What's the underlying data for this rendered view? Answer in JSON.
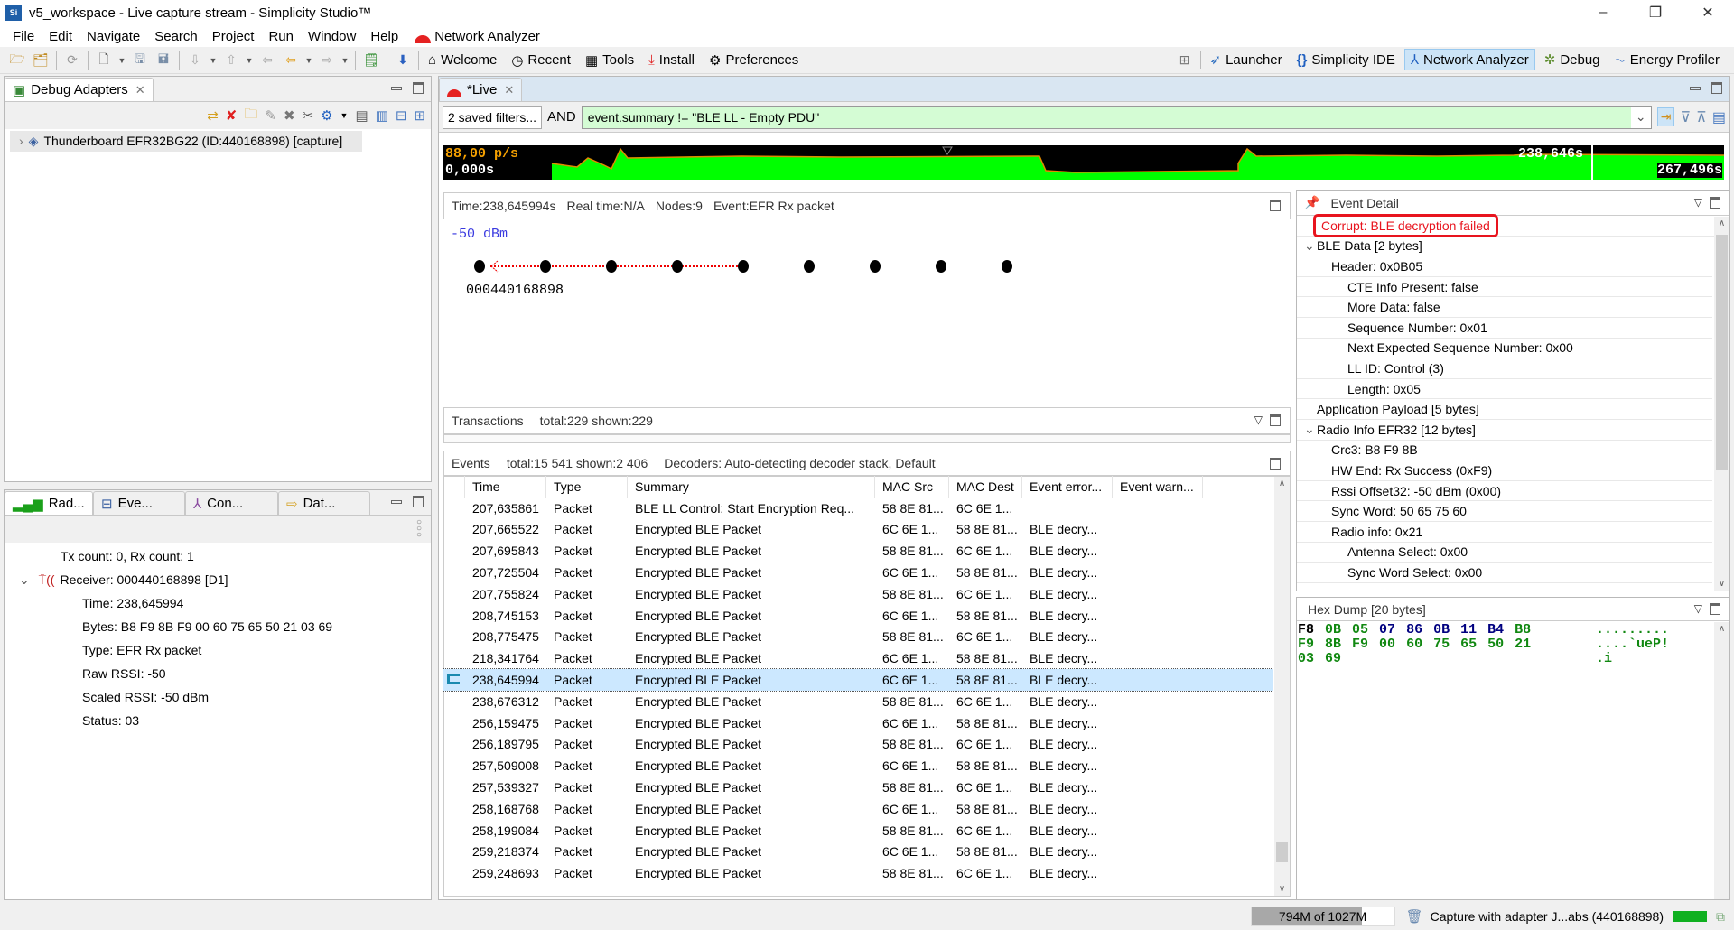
{
  "window": {
    "title": "v5_workspace - Live capture stream - Simplicity Studio™",
    "app_icon": "Si",
    "controls": [
      "–",
      "❐",
      "✕"
    ]
  },
  "menu": {
    "items": [
      "File",
      "Edit",
      "Navigate",
      "Search",
      "Project",
      "Run",
      "Window",
      "Help"
    ],
    "perspective_label": "Network Analyzer"
  },
  "toolbar": {
    "welcome": "Welcome",
    "recent": "Recent",
    "tools": "Tools",
    "install": "Install",
    "preferences": "Preferences"
  },
  "perspectives": {
    "launcher": "Launcher",
    "ide": "Simplicity IDE",
    "network_analyzer": "Network Analyzer",
    "debug": "Debug",
    "energy_profiler": "Energy Profiler",
    "active": "Network Analyzer"
  },
  "debug_adapters": {
    "tab_label": "Debug Adapters",
    "adapter": "Thunderboard EFR32BG22 (ID:440168898) [capture]"
  },
  "radio_panel": {
    "tabs": [
      "Rad...",
      "Eve...",
      "Con...",
      "Dat..."
    ],
    "tx_rx": "Tx count: 0, Rx count: 1",
    "receiver": "Receiver: 000440168898 [D1]",
    "fields": [
      "Time: 238,645994",
      "Bytes: B8 F9 8B F9 00 60 75 65 50 21 03 69",
      "Type: EFR Rx packet",
      "Raw RSSI: -50",
      "Scaled RSSI: -50 dBm",
      "Status: 03"
    ]
  },
  "editor": {
    "tab_label": "*Live",
    "saved_filters": "2 saved filters...",
    "and_label": "AND",
    "filter_value": "event.summary != \"BLE LL - Empty PDU\""
  },
  "timeline": {
    "rate": "88,00 p/s",
    "start_time": "0,000s",
    "cursor_time": "238,646s",
    "end_time": "267,496s"
  },
  "map": {
    "info": {
      "time": "Time:238,645994s",
      "real_time": "Real time:N/A",
      "nodes": "Nodes:9",
      "event": "Event:EFR Rx packet"
    },
    "rssi": "-50 dBm",
    "node_count": 9,
    "node_label": "000440168898"
  },
  "transactions": {
    "label": "Transactions",
    "stats": "total:229 shown:229"
  },
  "events": {
    "label": "Events",
    "stats": "total:15 541 shown:2 406",
    "decoders": "Decoders: Auto-detecting decoder stack, Default",
    "columns": [
      "Time",
      "Type",
      "Summary",
      "MAC Src",
      "MAC Dest",
      "Event error...",
      "Event warn..."
    ],
    "rows": [
      [
        "207,635861",
        "Packet",
        "BLE LL Control: Start Encryption Req...",
        "58 8E 81...",
        "6C 6E 1...",
        "",
        ""
      ],
      [
        "207,665522",
        "Packet",
        "Encrypted BLE Packet",
        "6C 6E 1...",
        "58 8E 81...",
        "BLE decry...",
        ""
      ],
      [
        "207,695843",
        "Packet",
        "Encrypted BLE Packet",
        "58 8E 81...",
        "6C 6E 1...",
        "BLE decry...",
        ""
      ],
      [
        "207,725504",
        "Packet",
        "Encrypted BLE Packet",
        "6C 6E 1...",
        "58 8E 81...",
        "BLE decry...",
        ""
      ],
      [
        "207,755824",
        "Packet",
        "Encrypted BLE Packet",
        "58 8E 81...",
        "6C 6E 1...",
        "BLE decry...",
        ""
      ],
      [
        "208,745153",
        "Packet",
        "Encrypted BLE Packet",
        "6C 6E 1...",
        "58 8E 81...",
        "BLE decry...",
        ""
      ],
      [
        "208,775475",
        "Packet",
        "Encrypted BLE Packet",
        "58 8E 81...",
        "6C 6E 1...",
        "BLE decry...",
        ""
      ],
      [
        "218,341764",
        "Packet",
        "Encrypted BLE Packet",
        "6C 6E 1...",
        "58 8E 81...",
        "BLE decry...",
        ""
      ],
      [
        "238,645994",
        "Packet",
        "Encrypted BLE Packet",
        "6C 6E 1...",
        "58 8E 81...",
        "BLE decry...",
        ""
      ],
      [
        "238,676312",
        "Packet",
        "Encrypted BLE Packet",
        "58 8E 81...",
        "6C 6E 1...",
        "BLE decry...",
        ""
      ],
      [
        "256,159475",
        "Packet",
        "Encrypted BLE Packet",
        "6C 6E 1...",
        "58 8E 81...",
        "BLE decry...",
        ""
      ],
      [
        "256,189795",
        "Packet",
        "Encrypted BLE Packet",
        "58 8E 81...",
        "6C 6E 1...",
        "BLE decry...",
        ""
      ],
      [
        "257,509008",
        "Packet",
        "Encrypted BLE Packet",
        "6C 6E 1...",
        "58 8E 81...",
        "BLE decry...",
        ""
      ],
      [
        "257,539327",
        "Packet",
        "Encrypted BLE Packet",
        "58 8E 81...",
        "6C 6E 1...",
        "BLE decry...",
        ""
      ],
      [
        "258,168768",
        "Packet",
        "Encrypted BLE Packet",
        "6C 6E 1...",
        "58 8E 81...",
        "BLE decry...",
        ""
      ],
      [
        "258,199084",
        "Packet",
        "Encrypted BLE Packet",
        "58 8E 81...",
        "6C 6E 1...",
        "BLE decry...",
        ""
      ],
      [
        "259,218374",
        "Packet",
        "Encrypted BLE Packet",
        "6C 6E 1...",
        "58 8E 81...",
        "BLE decry...",
        ""
      ],
      [
        "259,248693",
        "Packet",
        "Encrypted BLE Packet",
        "58 8E 81...",
        "6C 6E 1...",
        "BLE decry...",
        ""
      ]
    ],
    "selected_index": 8
  },
  "event_detail": {
    "label": "Event Detail",
    "error": "Corrupt: BLE decryption failed",
    "tree": [
      {
        "text": "BLE Data [2 bytes]",
        "level": 0,
        "expanded": true
      },
      {
        "text": "Header: 0x0B05",
        "level": 1
      },
      {
        "text": "CTE Info Present: false",
        "level": 2
      },
      {
        "text": "More Data: false",
        "level": 2
      },
      {
        "text": "Sequence Number: 0x01",
        "level": 2
      },
      {
        "text": "Next Expected Sequence Number: 0x00",
        "level": 2
      },
      {
        "text": "LL ID: Control (3)",
        "level": 2
      },
      {
        "text": "Length: 0x05",
        "level": 2
      },
      {
        "text": "Application Payload [5 bytes]",
        "level": 0
      },
      {
        "text": "Radio Info EFR32 [12 bytes]",
        "level": 0,
        "expanded": true
      },
      {
        "text": "Crc3: B8 F9 8B",
        "level": 1
      },
      {
        "text": "HW End: Rx Success (0xF9)",
        "level": 1
      },
      {
        "text": "Rssi Offset32: -50 dBm (0x00)",
        "level": 1
      },
      {
        "text": "Sync Word: 50 65 75 60",
        "level": 1
      },
      {
        "text": "Radio info: 0x21",
        "level": 1
      },
      {
        "text": "Antenna Select: 0x00",
        "level": 2
      },
      {
        "text": "Sync Word Select: 0x00",
        "level": 2
      }
    ]
  },
  "hex_dump": {
    "label": "Hex Dump [20 bytes]",
    "lines": [
      {
        "bytes": [
          [
            "F8",
            "#000000"
          ],
          [
            "0B",
            "#118811"
          ],
          [
            "05",
            "#118811"
          ],
          [
            "07",
            "#000080"
          ],
          [
            "86",
            "#000080"
          ],
          [
            "0B",
            "#000080"
          ],
          [
            "11",
            "#000080"
          ],
          [
            "B4",
            "#000080"
          ],
          [
            "B8",
            "#118811"
          ]
        ],
        "ascii": "........."
      },
      {
        "bytes": [
          [
            "F9",
            "#118811"
          ],
          [
            "8B",
            "#118811"
          ],
          [
            "F9",
            "#118811"
          ],
          [
            "00",
            "#118811"
          ],
          [
            "60",
            "#118811"
          ],
          [
            "75",
            "#118811"
          ],
          [
            "65",
            "#118811"
          ],
          [
            "50",
            "#118811"
          ],
          [
            "21",
            "#118811"
          ]
        ],
        "ascii": "....`ueP!"
      },
      {
        "bytes": [
          [
            "03",
            "#118811"
          ],
          [
            "69",
            "#118811"
          ]
        ],
        "ascii": ".i"
      }
    ]
  },
  "status_bar": {
    "memory": "794M of 1027M",
    "memory_used_fraction": 0.773,
    "capture": "Capture with adapter J...abs (440168898)"
  },
  "colors": {
    "accent": "#cce4f7",
    "error": "#e8141e",
    "selection": "#cce8ff",
    "timeline_fill": "#00ff00",
    "timeline_line": "#e08a00",
    "rssi_text": "#3a3ae0"
  }
}
